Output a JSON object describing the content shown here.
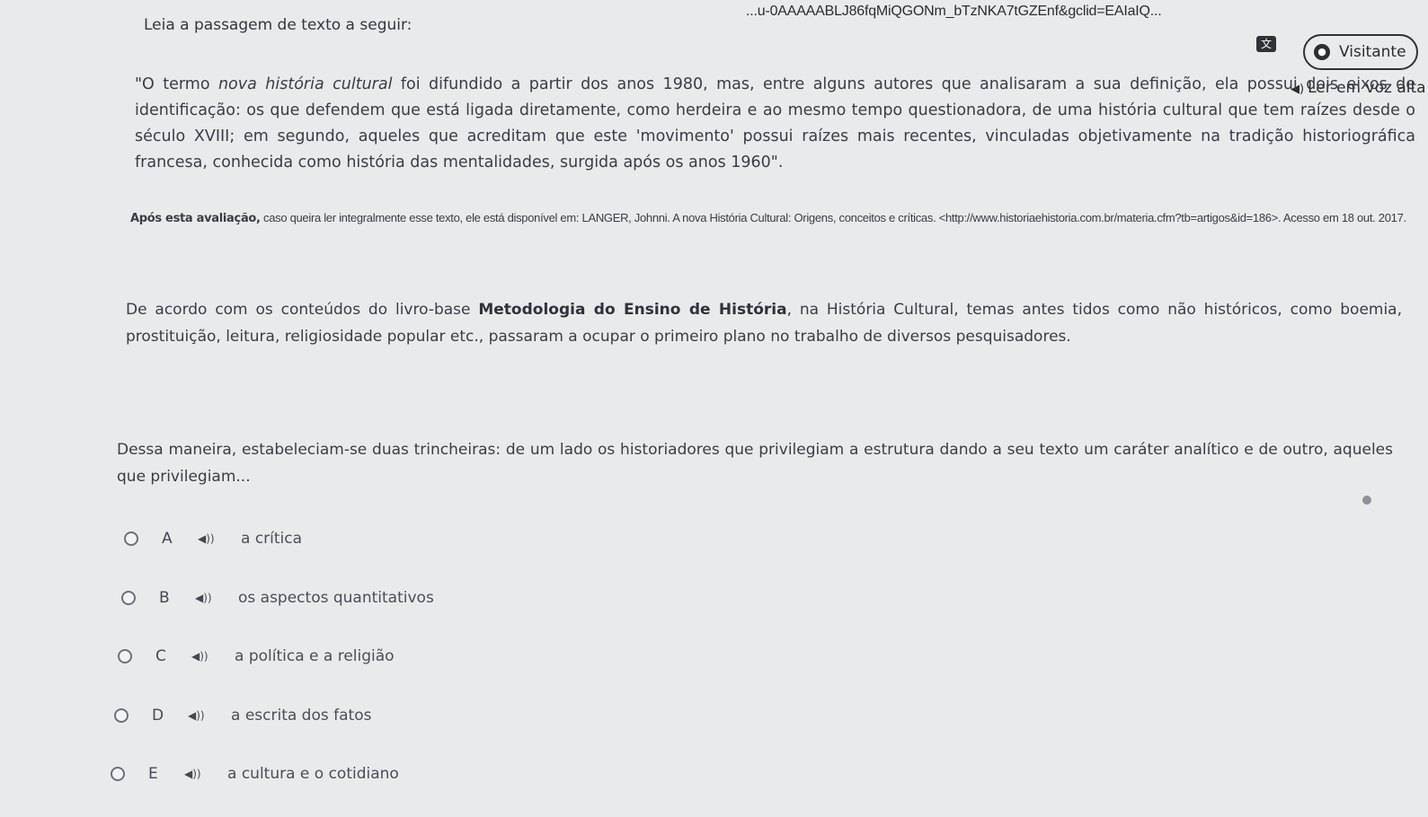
{
  "browser": {
    "url": "...u-0AAAAABLJ86fqMiQGONm_bTzNKA7tGZEnf&gclid=EAIaIQ...",
    "visitor_label": "Visitante",
    "read_aloud_label": "Ler em voz alta"
  },
  "content": {
    "intro": "Leia a passagem de texto a seguir:",
    "quote_part1": "\"O termo ",
    "quote_italic": "nova história cultural",
    "quote_part2": " foi difundido a partir dos anos 1980, mas, entre alguns autores que analisaram a sua definição, ela possui dois eixos de identificação: os que defendem que está ligada diretamente, como herdeira e ao mesmo tempo questionadora, de uma história cultural que tem raízes desde o século XVIII; em segundo, aqueles que acreditam que este 'movimento' possui raízes mais recentes, vinculadas objetivamente na tradição historiográfica francesa, conhecida como história das mentalidades, surgida após os anos 1960\".",
    "ref_bold": "Após esta avaliação,",
    "ref_text": " caso queira ler integralmente esse texto, ele está disponível em: LANGER, Johnni. A nova História Cultural: Origens, conceitos e críticas. <http://www.historiaehistoria.com.br/materia.cfm?tb=artigos&id=186>. Acesso em 18 out. 2017.",
    "question_part1": "De acordo com os conteúdos do livro-base ",
    "question_bold": "Metodologia do Ensino de História",
    "question_part2": ", na História Cultural, temas antes tidos como não históricos, como boemia, prostituição, leitura, religiosidade popular etc., passaram a ocupar o primeiro plano no trabalho de diversos pesquisadores.",
    "stem": "Dessa maneira, estabeleciam-se duas trincheiras: de um lado os historiadores que privilegiam a estrutura dando a seu texto um caráter analítico e de outro, aqueles que privilegiam..."
  },
  "options": [
    {
      "letter": "A",
      "text": "a crítica"
    },
    {
      "letter": "B",
      "text": "os aspectos quantitativos"
    },
    {
      "letter": "C",
      "text": "a política e a religião"
    },
    {
      "letter": "D",
      "text": "a escrita dos fatos"
    },
    {
      "letter": "E",
      "text": "a cultura e o cotidiano"
    }
  ],
  "icons": {
    "speaker": "speaker-icon",
    "translate": "translate-icon",
    "user": "user-icon"
  }
}
